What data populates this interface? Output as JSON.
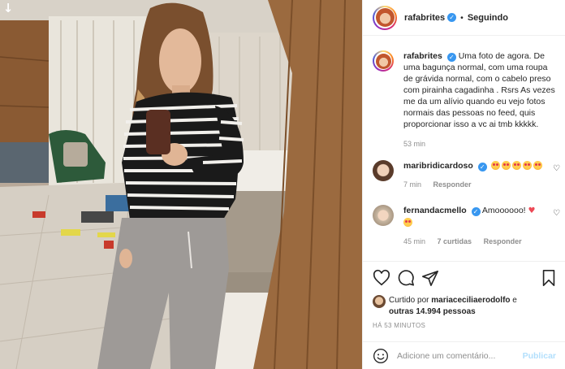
{
  "header": {
    "username": "rafabrites",
    "separator": "•",
    "follow_status": "Seguindo"
  },
  "caption": {
    "username": "rafabrites",
    "text": "Uma foto de agora. De uma bagunça normal, com uma roupa de grávida normal, com o cabelo preso com pirainha cagadinha . Rsrs As vezes me da um alívio quando eu vejo fotos normais das pessoas no feed, quis proporcionar isso a vc ai tmb kkkkk.",
    "age": "53 min"
  },
  "comments": [
    {
      "username": "maribridicardoso",
      "emoji_count": 5,
      "age": "7 min",
      "reply_label": "Responder"
    },
    {
      "username": "fernandacmello",
      "text": "Amoooooo!",
      "heart": "♥",
      "age": "45 min",
      "likes_label": "7 curtidas",
      "reply_label": "Responder"
    }
  ],
  "icons": {
    "download": "↓",
    "heart": "heart-icon",
    "comment": "comment-icon",
    "share": "share-icon",
    "save": "bookmark-icon",
    "small_heart": "♡",
    "check": "✓"
  },
  "likes": {
    "prefix": "Curtido por",
    "user": "mariaceciliaerodolfo",
    "and": "e",
    "others": "outras 14.994 pessoas"
  },
  "timestamp": "HÁ 53 MINUTOS",
  "add_comment": {
    "placeholder": "Adicione um comentário...",
    "publish_label": "Publicar"
  },
  "colors": {
    "verified": "#3897f0",
    "publish_disabled": "#b2dffc",
    "secondary_text": "#8e8e8e"
  }
}
